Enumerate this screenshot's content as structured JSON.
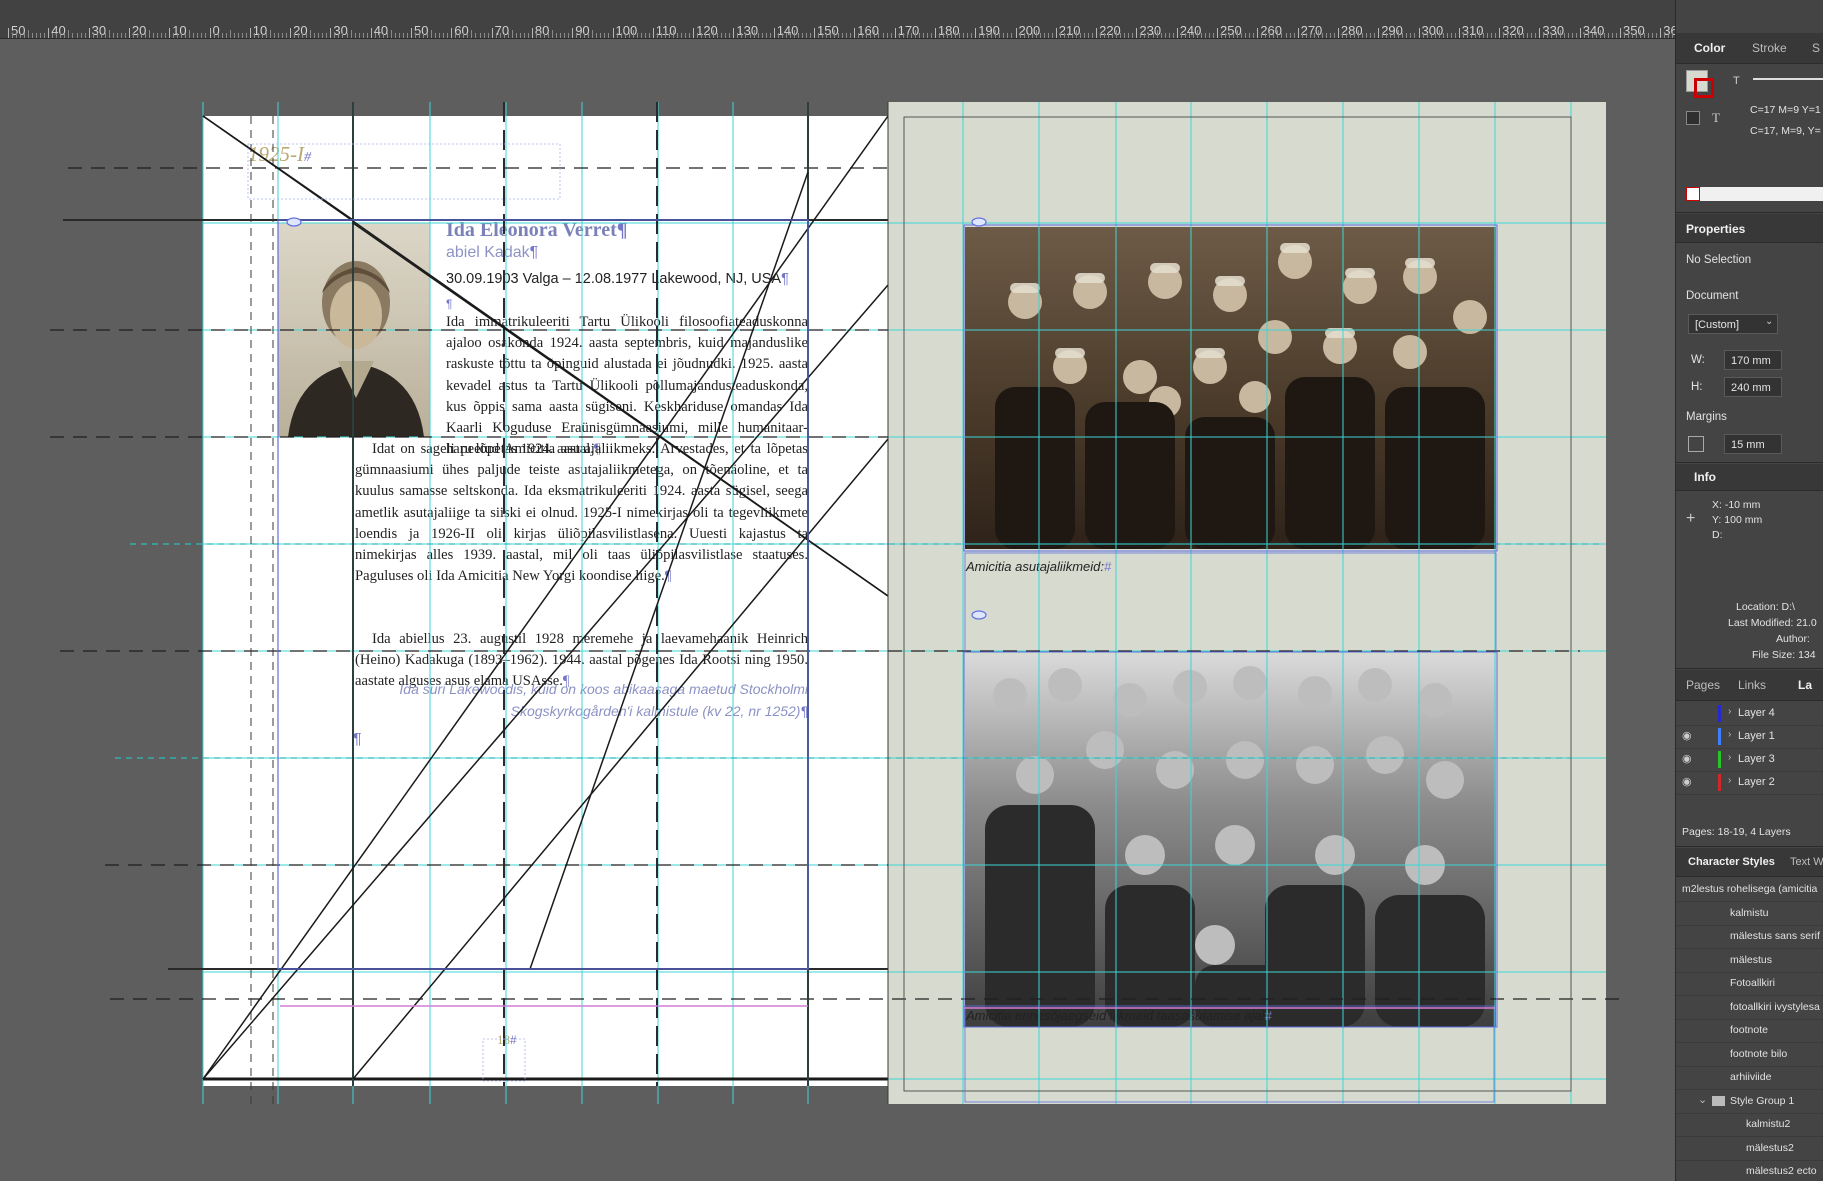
{
  "ruler": {
    "labels": [
      "50",
      "40",
      "30",
      "20",
      "10",
      "0",
      "10",
      "20",
      "30",
      "40",
      "50",
      "60",
      "70",
      "80",
      "90",
      "100",
      "110",
      "120",
      "130",
      "140",
      "150",
      "160",
      "170",
      "180",
      "190",
      "200",
      "210",
      "220",
      "230",
      "240",
      "250",
      "260",
      "270",
      "280",
      "290",
      "300",
      "310",
      "320",
      "330",
      "340",
      "350",
      "360"
    ]
  },
  "left_page": {
    "running_head": "1925-I",
    "name": "Ida Eleonora Verret",
    "married": "abiel Kadak",
    "life_dates": "30.09.1903 Valga – 12.08.1977 Lakewood, NJ, USA",
    "paragraph1": "Ida immatrikuleeriti Tartu Ülikooli filosoofiateaduskonna ajaloo osakonda 1924. aasta septembris, kuid majanduslike raskuste tõttu ta õpinguid alustada ei jõudnudki. 1925. aasta kevadel astus ta Tartu Ülikooli põllumajandusteaduskonda, kus õppis sama aasta sügiseni. Keskhariduse omandas Ida Kaarli Koguduse Eraünisgümnaasiumi, mille humanitaar-haru lõpetas 1924. aastal.",
    "paragraph2": "Idat on sageli peetud Amicitia asutajaliikmeks. Arvestades, et ta lõpetas gümnaasiumi ühes paljude teiste asutajaliikmetega, on tõenäoline, et ta kuulus samasse seltskonda. Ida eksmatrikuleeriti 1924. aasta sügisel, seega ametlik asutajaliige ta siiski ei olnud. 1925-I nimekirjas oli ta tegevliikmete loendis ja 1926-II oli kirjas üliõpilasvilistlasena. Uuesti kajastus ta nimekirjas alles 1939. aastal, mil oli taas üliõpilasvilistlase staatuses. Paguluses oli Ida Amicitia New Yorgi koondise liige.",
    "paragraph3": "Ida abiellus 23. augustil 1928 meremehe ja laevamehaanik Heinrich (Heino) Kadakuga (1893–1962). 1944. aastal põgenes Ida Rootsi ning 1950. aastate alguses asus elama USAsse.",
    "burial_line1": "Ida suri Lakewoodis, kuid on koos abikaasaga maetud Stockholmi",
    "burial_line2": "Skogskyrkogården'i kalmistule (kv 22, nr 1252)",
    "pilcrow": "¶",
    "hash": "#",
    "folio": "18"
  },
  "right_page": {
    "caption_top": "Amicitia asutajaliikmeid:",
    "caption_bottom": "Amicitia ennesõjaegseid liikmeid taasasutamise ajal"
  },
  "panels": {
    "color": {
      "tabs": [
        "Color",
        "Stroke",
        "S"
      ],
      "cmyk_line1": "C=17 M=9 Y=1",
      "cmyk_line2": "C=17, M=9, Y="
    },
    "properties": {
      "title": "Properties",
      "selection": "No Selection",
      "document_label": "Document",
      "preset": "[Custom]",
      "w_label": "W:",
      "w_value": "170 mm",
      "h_label": "H:",
      "h_value": "240 mm",
      "margins_label": "Margins",
      "margins_value": "15 mm"
    },
    "info": {
      "title": "Info",
      "x": "X: -10 mm",
      "y": "Y: 100 mm",
      "d": "D:",
      "location": "Location: D:\\",
      "last_modified": "Last Modified: 21.0",
      "author": "Author:",
      "file_size": "File Size: 134"
    },
    "pages": {
      "tabs": [
        "Pages",
        "Links",
        "La"
      ],
      "layers": [
        {
          "name": "Layer 4",
          "color": "#2727d0",
          "visible": false
        },
        {
          "name": "Layer 1",
          "color": "#3f7fff",
          "visible": true
        },
        {
          "name": "Layer 3",
          "color": "#28c428",
          "visible": true
        },
        {
          "name": "Layer 2",
          "color": "#d02828",
          "visible": true
        }
      ],
      "footer": "Pages: 18-19, 4 Layers"
    },
    "char_styles": {
      "tabs": [
        "Character Styles",
        "Text W"
      ],
      "items": [
        "m2lestus rohelisega (amicitia",
        "kalmistu",
        "mälestus sans serif",
        "mälestus",
        "Fotoallkiri",
        "fotoallkiri ivystylesa",
        "footnote",
        "footnote bilo",
        "arhiiviide"
      ],
      "group": "Style Group 1",
      "group_items": [
        "kalmistu2",
        "mälestus2",
        "mälestus2 ecto"
      ]
    }
  },
  "colors": {
    "cyan_guide": "#3dd6d6",
    "frame_blue": "#5f6ee0",
    "pilcrow": "#7577c8",
    "paper_right": "#d7dbcf",
    "pasteboard": "#5e5e5e"
  }
}
